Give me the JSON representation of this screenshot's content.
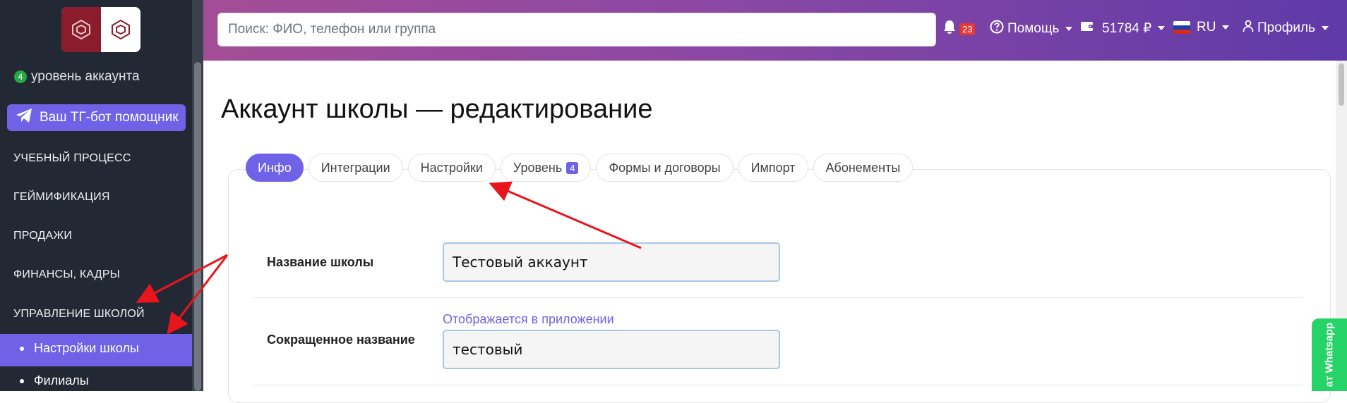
{
  "sidebar": {
    "account_level_badge": "4",
    "account_level_text": "уровень аккаунта",
    "tg_button": "Ваш ТГ-бот помощник",
    "sections": [
      "УЧЕБНЫЙ ПРОЦЕСС",
      "ГЕЙМИФИКАЦИЯ",
      "ПРОДАЖИ",
      "ФИНАНСЫ, КАДРЫ",
      "УПРАВЛЕНИЕ ШКОЛОЙ"
    ],
    "subitems": [
      "Настройки школы",
      "Филиалы"
    ]
  },
  "header": {
    "search_placeholder": "Поиск: ФИО, телефон или группа",
    "notifications_count": "23",
    "help_label": "Помощь",
    "balance_label": "51784 ₽",
    "language_label": "RU",
    "profile_label": "Профиль"
  },
  "page": {
    "title": "Аккаунт школы — редактирование"
  },
  "tabs": {
    "info": "Инфо",
    "integrations": "Интеграции",
    "settings": "Настройки",
    "level": "Уровень",
    "level_badge": "4",
    "forms": "Формы и договоры",
    "import": "Импорт",
    "subscriptions": "Абонементы"
  },
  "form": {
    "school_name_label": "Название школы",
    "school_name_value": "Тестовый аккаунт",
    "short_name_label": "Сокращенное название",
    "short_name_hint": "Отображается в приложении",
    "short_name_value": "тестовый"
  },
  "whatsapp": {
    "label": "ат Whatsapp"
  },
  "colors": {
    "accent": "#6f62e6",
    "sidebar_bg": "#232934",
    "annotation_arrow": "#e8161c"
  }
}
